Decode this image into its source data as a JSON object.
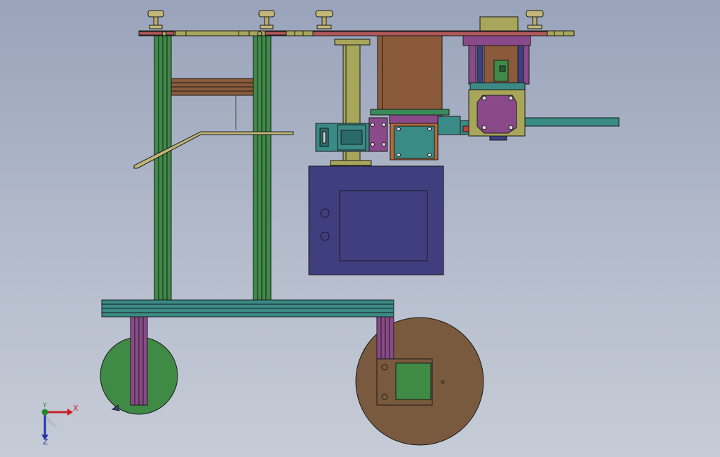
{
  "view": {
    "background_top": "#99a3ba",
    "background_bottom": "#c6ccd6"
  },
  "triad": {
    "x_label": "X",
    "y_label": "Y",
    "z_label": "Z",
    "x_color": "#c8202a",
    "y_color": "#1d8a2a",
    "z_color": "#2233aa"
  },
  "colors": {
    "frame_green": "#3f8a48",
    "frame_olive": "#a8a65a",
    "plate_purple": "#8a4a8a",
    "motor_brown": "#8a5a3a",
    "teal": "#3a8a86",
    "box_blue": "#3f3f80",
    "wheel_green": "#3f8a44",
    "wheel_brown": "#7a5a3e",
    "edge": "#1a1a1a"
  }
}
